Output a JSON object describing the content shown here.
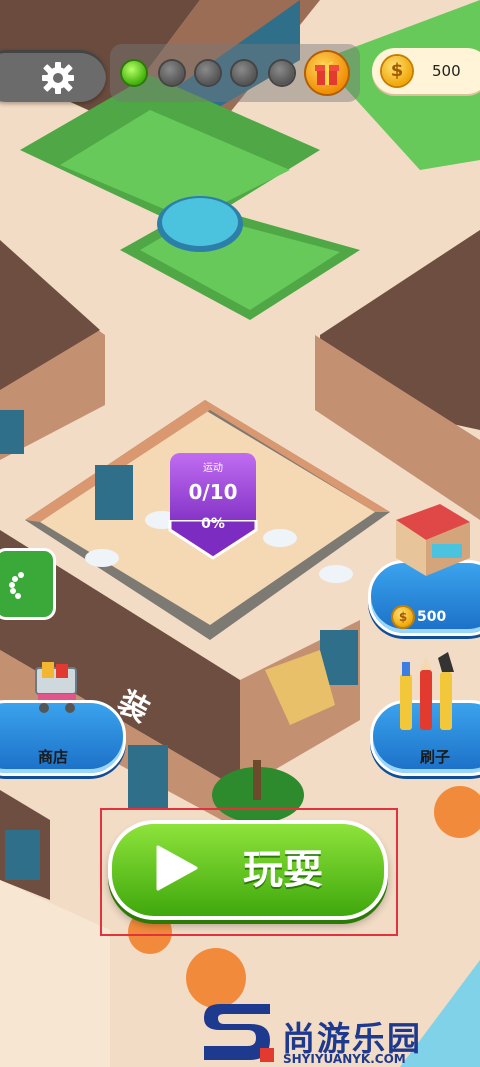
{
  "hud": {
    "settings_icon": "gear-icon",
    "progress_dots": {
      "active_count": 1,
      "total": 5
    },
    "gift_icon": "gift-icon",
    "coins": "500",
    "coin_icon": "dollar-coin-icon"
  },
  "task_marker": {
    "title": "运动",
    "count": "0/10",
    "percent": "0%"
  },
  "shop_button": {
    "label": "商店",
    "icon": "shopping-cart-icon"
  },
  "kiosk_button": {
    "price": "500",
    "icon": "shop-stall-icon"
  },
  "brush_button": {
    "label": "刷子",
    "icon": "paint-brushes-icon"
  },
  "floor_sign": "装",
  "play_button": {
    "label": "玩耍",
    "icon": "play-icon"
  },
  "watermark": {
    "brand": "尚游乐园",
    "site": "SHYIYUANYK.COM"
  },
  "colors": {
    "accent_green": "#3fa80c",
    "accent_blue": "#1b6fc6",
    "accent_purple": "#7c2cc0",
    "highlight_red": "#e0333e"
  }
}
